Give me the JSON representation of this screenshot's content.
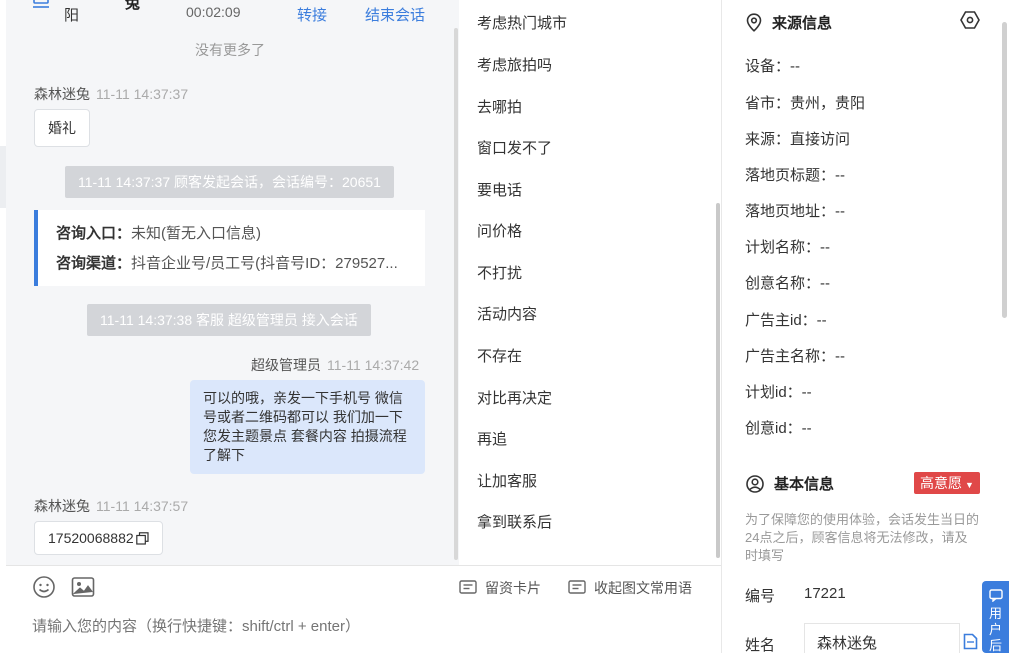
{
  "header": {
    "customer_name_part": "阳",
    "customer_name_partial": "兔",
    "duration": "00:02:09",
    "transfer_label": "转接",
    "end_label": "结束会话"
  },
  "chat": {
    "no_more": "没有更多了",
    "msg1": {
      "sender": "森林迷兔",
      "time": "11-11 14:37:37",
      "text": "婚礼"
    },
    "sys1": "11-11 14:37:37 顾客发起会话，会话编号：20651",
    "entry": {
      "label1": "咨询入口：",
      "value1": "未知(暂无入口信息)",
      "label2": "咨询渠道：",
      "value2": "抖音企业号/员工号(抖音号ID：279527..."
    },
    "sys2": "11-11 14:37:38 客服 超级管理员 接入会话",
    "msg2": {
      "sender": "超级管理员",
      "time": "11-11 14:37:42",
      "text": "可以的哦，亲发一下手机号 微信号或者二维码都可以 我们加一下您发主题景点 套餐内容 拍摄流程了解下"
    },
    "msg3": {
      "sender": "森林迷兔",
      "time": "11-11 14:37:57",
      "text": "17520068882"
    }
  },
  "toolbar": {
    "emoji_icon": "smile-icon",
    "image_icon": "image-icon",
    "card_label": "留资卡片",
    "collapse_label": "收起图文常用语",
    "placeholder": "请输入您的内容（换行快捷键：shift/ctrl + enter）"
  },
  "phrases": [
    "考虑热门城市",
    "考虑旅拍吗",
    "去哪拍",
    "窗口发不了",
    "要电话",
    "问价格",
    "不打扰",
    "活动内容",
    "不存在",
    "对比再决定",
    "再追",
    "让加客服",
    "拿到联系后"
  ],
  "source": {
    "title": "来源信息",
    "device": "设备：--",
    "province": "省市：贵州，贵阳",
    "origin": "来源：直接访问",
    "landing_title": "落地页标题：--",
    "landing_url": "落地页地址：--",
    "plan_name": "计划名称：--",
    "creative_name": "创意名称：--",
    "advertiser_id": "广告主id：--",
    "advertiser_name": "广告主名称：--",
    "plan_id": "计划id：--",
    "creative_id": "创意id：--"
  },
  "basic": {
    "title": "基本信息",
    "intent_tag": "高意愿",
    "note": "为了保障您的使用体验，会话发生当日的24点之后，顾客信息将无法修改，请及时填写",
    "id_label": "编号",
    "id_value": "17221",
    "name_label": "姓名",
    "name_value": "森林迷兔"
  },
  "float_tab": "用户后",
  "colors": {
    "accent": "#3b7ddd",
    "tag_red": "#e04848",
    "bubble_right": "#dbe7fb"
  }
}
